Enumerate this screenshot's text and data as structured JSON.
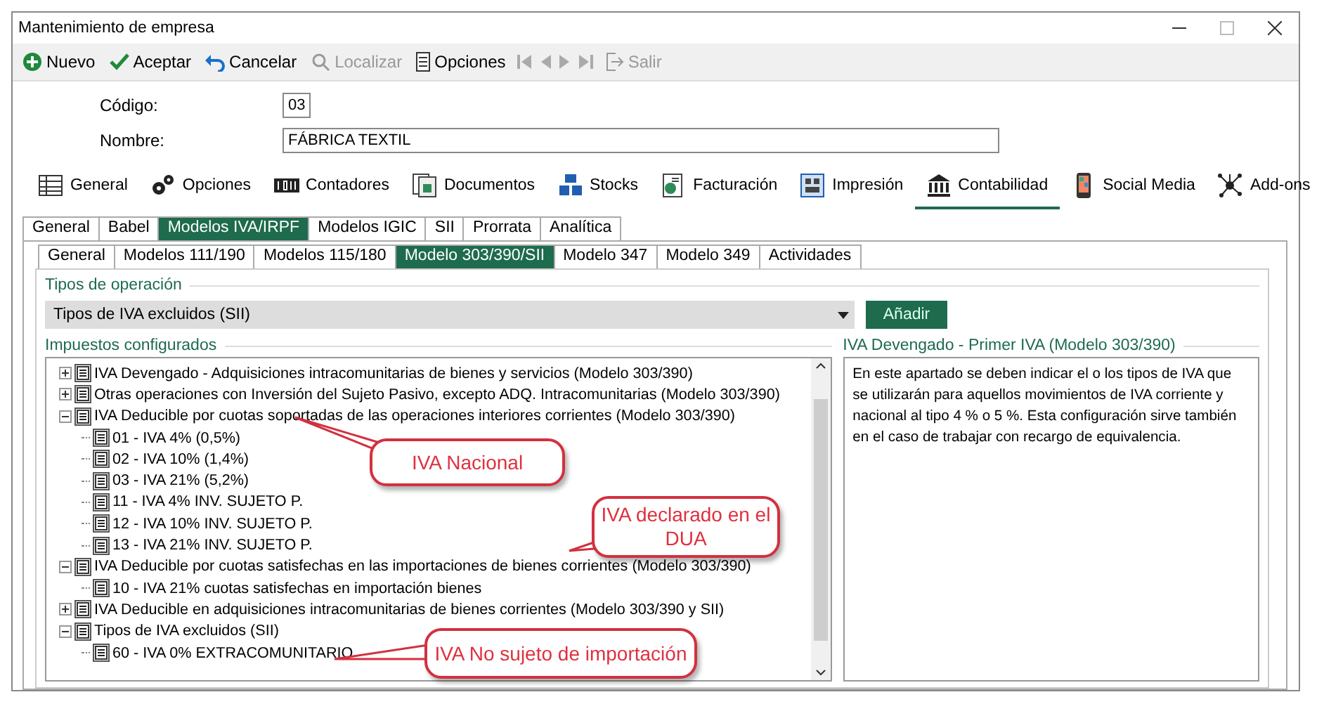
{
  "window": {
    "title": "Mantenimiento de empresa"
  },
  "toolbar": [
    {
      "kind": "plus",
      "label": "Nuevo",
      "disabled": false
    },
    {
      "kind": "check",
      "label": "Aceptar",
      "disabled": false
    },
    {
      "kind": "undo",
      "label": "Cancelar",
      "disabled": false
    },
    {
      "kind": "search",
      "label": "Localizar",
      "disabled": true
    },
    {
      "kind": "list",
      "label": "Opciones",
      "disabled": false
    },
    {
      "kind": "first",
      "disabled": true
    },
    {
      "kind": "prev",
      "disabled": true
    },
    {
      "kind": "next",
      "disabled": true
    },
    {
      "kind": "last",
      "disabled": true
    },
    {
      "kind": "exit",
      "label": "Salir",
      "disabled": true
    }
  ],
  "fields": [
    {
      "label": "Código:",
      "value": "03",
      "kind": "short"
    },
    {
      "label": "Nombre:",
      "value": "FÁBRICA TEXTIL",
      "kind": "long"
    }
  ],
  "main_tabs": [
    {
      "label": "General",
      "kind": "table",
      "selected": false
    },
    {
      "label": "Opciones",
      "kind": "gears",
      "selected": false
    },
    {
      "label": "Contadores",
      "kind": "counter",
      "selected": false
    },
    {
      "label": "Documentos",
      "kind": "docs",
      "selected": false
    },
    {
      "label": "Stocks",
      "kind": "boxes",
      "selected": false
    },
    {
      "label": "Facturación",
      "kind": "invoice",
      "selected": false
    },
    {
      "label": "Impresión",
      "kind": "print",
      "selected": false
    },
    {
      "label": "Contabilidad",
      "kind": "bank",
      "selected": true
    },
    {
      "label": "Social Media",
      "kind": "phone",
      "selected": false
    },
    {
      "label": "Add-ons",
      "kind": "network",
      "selected": false
    }
  ],
  "tabs": [
    {
      "label": "General",
      "selected": false
    },
    {
      "label": "Babel",
      "selected": false
    },
    {
      "label": "Modelos IVA/IRPF",
      "selected": true
    },
    {
      "label": "Modelos IGIC",
      "selected": false
    },
    {
      "label": "SII",
      "selected": false
    },
    {
      "label": "Prorrata",
      "selected": false
    },
    {
      "label": "Analítica",
      "selected": false
    }
  ],
  "subtabs": [
    {
      "label": "General",
      "selected": false
    },
    {
      "label": "Modelos 111/190",
      "selected": false
    },
    {
      "label": "Modelos 115/180",
      "selected": false
    },
    {
      "label": "Modelo 303/390/SII",
      "selected": true
    },
    {
      "label": "Modelo 347",
      "selected": false
    },
    {
      "label": "Modelo 349",
      "selected": false
    },
    {
      "label": "Actividades",
      "selected": false
    }
  ],
  "operation": {
    "legend": "Tipos de operación",
    "value": "Tipos de IVA excluidos (SII)",
    "button": "Añadir"
  },
  "taxes": {
    "legend": "Impuestos configurados",
    "tree": [
      {
        "label": "IVA Devengado - Adquisiciones intracomunitarias de bienes y servicios (Modelo 303/390)",
        "expanded": false
      },
      {
        "label": "Otras operaciones con Inversión del Sujeto Pasivo, excepto ADQ. Intracomunitarias (Modelo 303/390)",
        "expanded": false
      },
      {
        "label": "IVA Deducible por cuotas soportadas de las operaciones interiores corrientes (Modelo 303/390)",
        "expanded": true,
        "children": [
          {
            "label": "01 - IVA 4% (0,5%)"
          },
          {
            "label": "02 - IVA 10% (1,4%)"
          },
          {
            "label": "03 - IVA 21% (5,2%)"
          },
          {
            "label": "11 - IVA 4% INV. SUJETO P."
          },
          {
            "label": "12 - IVA 10% INV. SUJETO P."
          },
          {
            "label": "13 - IVA 21% INV. SUJETO P."
          }
        ]
      },
      {
        "label": "IVA Deducible por cuotas satisfechas en las importaciones de bienes corrientes (Modelo 303/390)",
        "expanded": true,
        "children": [
          {
            "label": "10 - IVA 21% cuotas satisfechas en importación bienes"
          }
        ]
      },
      {
        "label": "IVA Deducible en adquisiciones intracomunitarias de bienes corrientes (Modelo 303/390 y SII)",
        "expanded": false
      },
      {
        "label": "Tipos de IVA excluidos (SII)",
        "expanded": true,
        "children": [
          {
            "label": "60 - IVA 0% EXTRACOMUNITARIO"
          }
        ]
      }
    ]
  },
  "description": {
    "legend": "IVA Devengado - Primer IVA (Modelo 303/390)",
    "text": "En este apartado se deben indicar el o los tipos de IVA que se utilizarán para aquellos movimientos de IVA corriente y nacional al tipo 4 % o 5 %. Esta configuración sirve también en el caso de trabajar con recargo de equivalencia."
  },
  "callouts": [
    {
      "text": "IVA Nacional"
    },
    {
      "text": "IVA declarado en el DUA"
    },
    {
      "text": "IVA No sujeto de importación"
    }
  ]
}
